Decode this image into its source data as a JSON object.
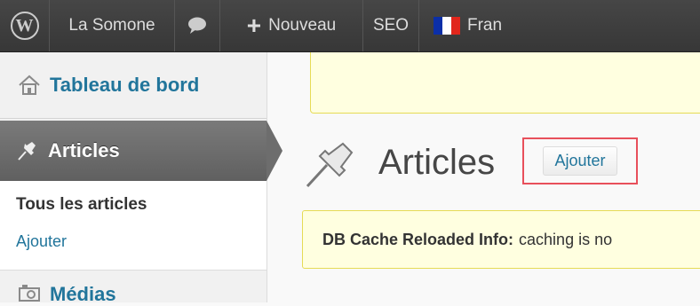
{
  "adminbar": {
    "site_name": "La Somone",
    "new_label": "Nouveau",
    "seo_label": "SEO",
    "language_label": "Fran",
    "icons": [
      "wordpress-logo-icon",
      "comment-bubble-icon",
      "plus-icon",
      "french-flag-icon"
    ],
    "colors": {
      "bar": "#3e3e3e",
      "text": "#dddddd"
    }
  },
  "sidebar": {
    "dashboard": "Tableau de bord",
    "articles": "Articles",
    "submenu": {
      "all": "Tous les articles",
      "add": "Ajouter"
    },
    "media": "Médias",
    "colors": {
      "link": "#21759b",
      "active_bg": "#6d6d6d"
    }
  },
  "main": {
    "title": "Articles",
    "add_button": "Ajouter",
    "notice": {
      "label": "DB Cache Reloaded Info:",
      "text": "caching is no"
    },
    "colors": {
      "notice_bg": "#ffffe0",
      "notice_border": "#e6db55",
      "highlight": "#e8505b"
    }
  }
}
